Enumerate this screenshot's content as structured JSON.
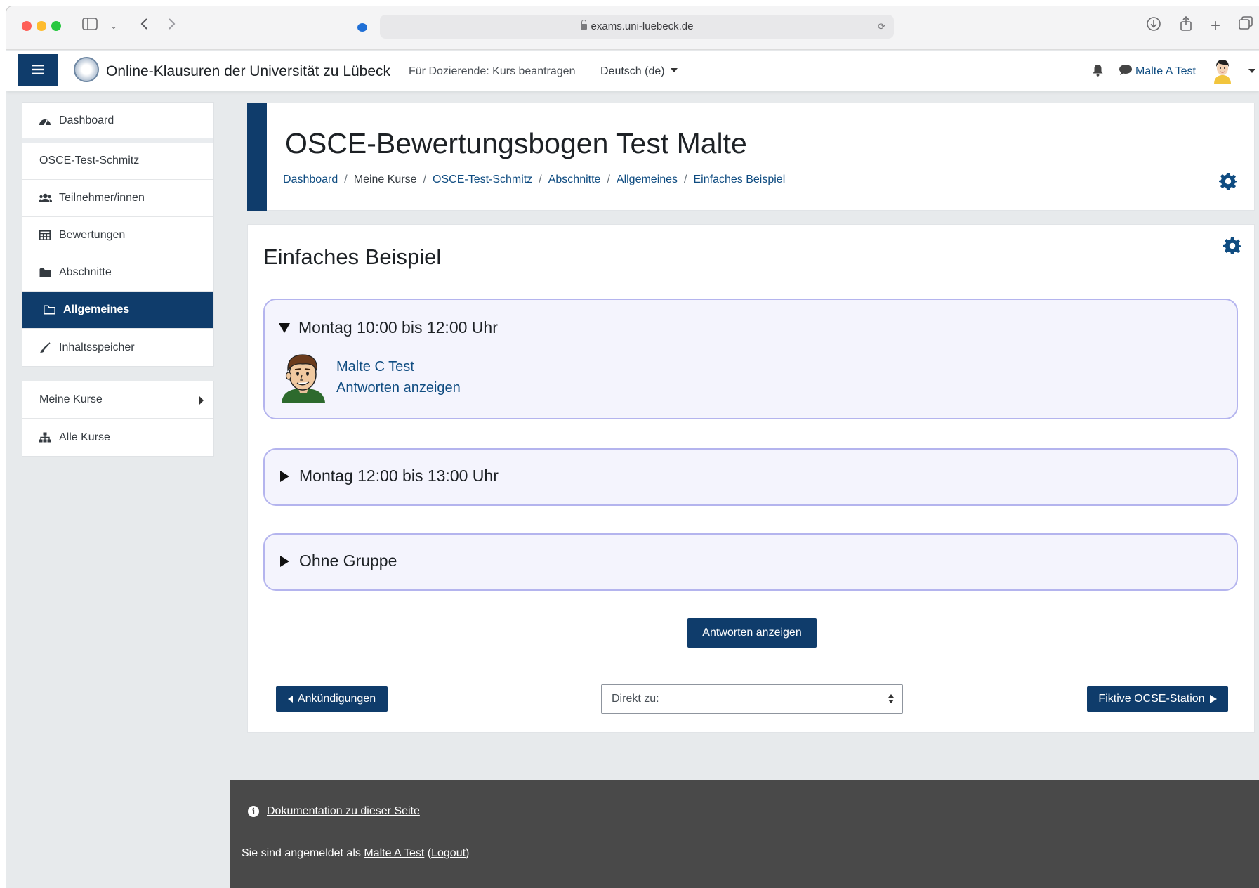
{
  "browser": {
    "url": "exams.uni-luebeck.de"
  },
  "navbar": {
    "site_title": "Online-Klausuren der Universität zu Lübeck",
    "request_course": "Für Dozierende: Kurs beantragen",
    "language": "Deutsch (de)",
    "user_name": "Malte A Test"
  },
  "sidebar": {
    "items": [
      {
        "label": "Dashboard",
        "icon": "dashboard-icon"
      },
      {
        "label": "OSCE-Test-Schmitz",
        "icon": ""
      },
      {
        "label": "Teilnehmer/innen",
        "icon": "users-icon"
      },
      {
        "label": "Bewertungen",
        "icon": "table-icon"
      },
      {
        "label": "Abschnitte",
        "icon": "folder-icon"
      },
      {
        "label": "Allgemeines",
        "icon": "folder-open-icon"
      },
      {
        "label": "Inhaltsspeicher",
        "icon": "brush-icon"
      }
    ],
    "my_courses": "Meine Kurse",
    "all_courses": "Alle Kurse"
  },
  "header": {
    "title": "OSCE-Bewertungsbogen Test Malte",
    "breadcrumb": [
      "Dashboard",
      "Meine Kurse",
      "OSCE-Test-Schmitz",
      "Abschnitte",
      "Allgemeines",
      "Einfaches Beispiel"
    ]
  },
  "main": {
    "activity_title": "Einfaches Beispiel",
    "groups": [
      {
        "title": "Montag 10:00 bis 12:00 Uhr",
        "expanded": true,
        "member_name": "Malte C Test",
        "member_action": "Antworten anzeigen"
      },
      {
        "title": "Montag 12:00 bis 13:00 Uhr",
        "expanded": false
      },
      {
        "title": "Ohne Gruppe",
        "expanded": false
      }
    ],
    "show_answers_button": "Antworten anzeigen",
    "prev_button": "Ankündigungen",
    "jump_select": "Direkt zu:",
    "next_button": "Fiktive OCSE-Station"
  },
  "footer": {
    "doc_link": "Dokumentation zu dieser Seite",
    "logged_in_prefix": "Sie sind angemeldet als",
    "logged_in_user": "Malte A Test",
    "logout": "Logout"
  },
  "colors": {
    "primary": "#0f3c6b",
    "link": "#0f4c81",
    "group_bg": "#f4f4fd",
    "group_border": "#b4b4ee",
    "footer_bg": "#494949"
  }
}
